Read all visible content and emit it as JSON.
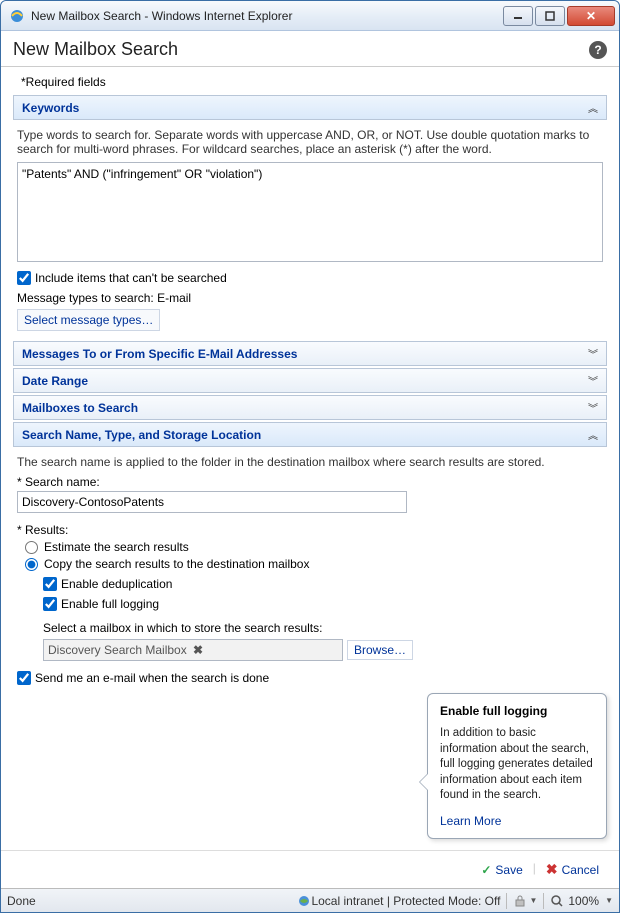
{
  "window": {
    "title": "New Mailbox Search - Windows Internet Explorer"
  },
  "page": {
    "title": "New Mailbox Search",
    "required_fields_label": "*Required fields"
  },
  "keywords": {
    "header": "Keywords",
    "hint": "Type words to search for. Separate words with uppercase AND, OR, or NOT. Use double quotation marks to search for multi-word phrases. For wildcard searches, place an asterisk (*) after the word.",
    "value": "\"Patents\" AND (\"infringement\" OR \"violation\")",
    "include_unsearchable_label": "Include items that can't be searched",
    "include_unsearchable_checked": true,
    "message_types_label": "Message types to search: E-mail",
    "select_message_types": "Select message types…"
  },
  "sections": {
    "messages": "Messages To or From Specific E-Mail Addresses",
    "date_range": "Date Range",
    "mailboxes": "Mailboxes to Search",
    "name_type": "Search Name, Type, and Storage Location"
  },
  "name_type": {
    "description": "The search name is applied to the folder in the destination mailbox where search results are stored.",
    "search_name_label": "* Search name:",
    "search_name_value": "Discovery-ContosoPatents",
    "results_label": "* Results:",
    "estimate_label": "Estimate the search results",
    "copy_label": "Copy the search results to the destination mailbox",
    "dedup_label": "Enable deduplication",
    "full_log_label": "Enable full logging",
    "select_mailbox_label": "Select a mailbox in which to store the search results:",
    "mailbox_value": "Discovery Search Mailbox",
    "browse_label": "Browse…",
    "email_when_done_label": "Send me an e-mail when the search is done"
  },
  "tooltip": {
    "title": "Enable full logging",
    "body": "In addition to basic information about the search, full logging generates detailed information about each item found in the search.",
    "learn_more": "Learn More"
  },
  "footer": {
    "save": "Save",
    "cancel": "Cancel"
  },
  "statusbar": {
    "done": "Done",
    "zone": "Local intranet | Protected Mode: Off",
    "zoom": "100%"
  }
}
